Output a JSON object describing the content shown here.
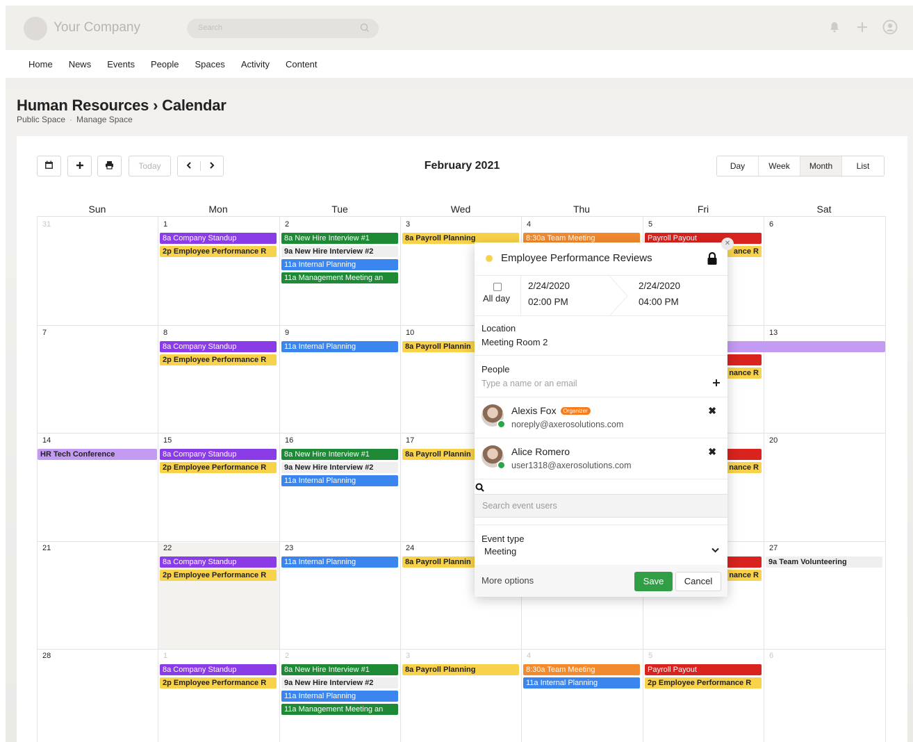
{
  "header": {
    "company": "Your Company",
    "search_placeholder": "Search"
  },
  "nav": [
    "Home",
    "News",
    "Events",
    "People",
    "Spaces",
    "Activity",
    "Content"
  ],
  "page": {
    "title": "Human Resources › Calendar",
    "space_type": "Public Space",
    "manage": "Manage Space"
  },
  "toolbar": {
    "today": "Today",
    "month_title": "February 2021",
    "views": [
      "Day",
      "Week",
      "Month",
      "List"
    ],
    "active_view": "Month"
  },
  "days_of_week": [
    "Sun",
    "Mon",
    "Tue",
    "Wed",
    "Thu",
    "Fri",
    "Sat"
  ],
  "weeks": [
    [
      "31",
      "1",
      "2",
      "3",
      "4",
      "5",
      "6"
    ],
    [
      "7",
      "8",
      "9",
      "10",
      "",
      "",
      "13"
    ],
    [
      "14",
      "15",
      "16",
      "17",
      "",
      "",
      "20"
    ],
    [
      "21",
      "22",
      "23",
      "24",
      "",
      "",
      "27"
    ],
    [
      "28",
      "1",
      "2",
      "3",
      "4",
      "5",
      "6"
    ]
  ],
  "events": {
    "w1": {
      "mon": [
        "8a Company Standup",
        "2p Employee Performance R"
      ],
      "tue": [
        "8a New Hire Interview #1",
        "9a New Hire Interview #2",
        "11a Internal Planning",
        "11a Management Meeting an"
      ],
      "wed": [
        "8a Payroll Planning"
      ],
      "thu": [
        "8:30a Team Meeting"
      ],
      "fri": [
        "Payroll Payout",
        "ance R"
      ]
    },
    "w2": {
      "mon": [
        "8a Company Standup",
        "2p Employee Performance R"
      ],
      "tue": [
        "11a Internal Planning"
      ],
      "wed": [
        "8a Payroll Plannin"
      ],
      "fri": [
        "nance R"
      ]
    },
    "w3": {
      "sun": "HR Tech Conference",
      "mon": [
        "8a Company Standup",
        "2p Employee Performance R"
      ],
      "tue": [
        "8a New Hire Interview #1",
        "9a New Hire Interview #2",
        "11a Internal Planning"
      ],
      "wed": [
        "8a Payroll Plannin"
      ],
      "fri": [
        "nance R"
      ]
    },
    "w4": {
      "mon": [
        "8a Company Standup",
        "2p Employee Performance R"
      ],
      "tue": [
        "11a Internal Planning"
      ],
      "wed": [
        "8a Payroll Plannin"
      ],
      "fri": [
        "nance R"
      ],
      "sat": [
        "9a Team Volunteering"
      ]
    },
    "w5": {
      "mon": [
        "8a Company Standup",
        "2p Employee Performance R"
      ],
      "tue": [
        "8a New Hire Interview #1",
        "9a New Hire Interview #2",
        "11a Internal Planning",
        "11a Management Meeting an"
      ],
      "wed": [
        "8a Payroll Planning"
      ],
      "thu": [
        "8:30a Team Meeting",
        "11a Internal Planning"
      ],
      "fri": [
        "Payroll Payout",
        "2p Employee Performance R"
      ]
    }
  },
  "popup": {
    "title": "Employee Performance Reviews",
    "all_day": "All day",
    "start_date": "2/24/2020",
    "start_time": "02:00 PM",
    "end_date": "2/24/2020",
    "end_time": "04:00 PM",
    "location_label": "Location",
    "location": "Meeting Room 2",
    "people_label": "People",
    "people_placeholder": "Type a name or an email",
    "people": [
      {
        "name": "Alexis Fox",
        "badge": "Organizer",
        "email": "noreply@axerosolutions.com"
      },
      {
        "name": "Alice Romero",
        "email": "user1318@axerosolutions.com"
      }
    ],
    "search_users_placeholder": "Search event users",
    "event_type_label": "Event type",
    "event_type": "Meeting",
    "more_options": "More options",
    "save": "Save",
    "cancel": "Cancel"
  },
  "colors": {
    "purple": "#8a3ce6",
    "yellow": "#f8d24a",
    "green": "#1e8a36",
    "blue": "#3b86ee",
    "orange": "#f28a2e",
    "red": "#d8231f",
    "lavender": "#c49bf2",
    "save_green": "#2f9e44"
  }
}
